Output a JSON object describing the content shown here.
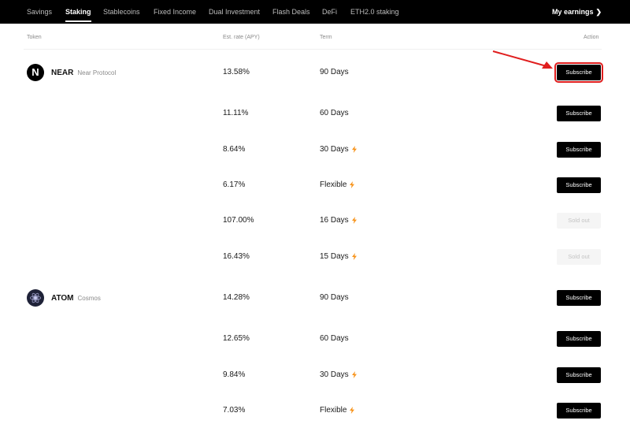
{
  "nav": {
    "items": [
      "Savings",
      "Staking",
      "Stablecoins",
      "Fixed Income",
      "Dual Investment",
      "Flash Deals",
      "DeFi",
      "ETH2.0 staking"
    ],
    "active": "Staking",
    "right": "My earnings"
  },
  "table": {
    "headers": {
      "token": "Token",
      "rate": "Est. rate (APY)",
      "term": "Term",
      "action": "Action"
    },
    "rows": [
      {
        "symbol": "NEAR",
        "name": "Near Protocol",
        "rate": "13.58%",
        "term": "90 Days",
        "flash": false,
        "action": "Subscribe",
        "highlighted": true
      },
      {
        "symbol": "",
        "name": "",
        "rate": "11.11%",
        "term": "60 Days",
        "flash": false,
        "action": "Subscribe"
      },
      {
        "symbol": "",
        "name": "",
        "rate": "8.64%",
        "term": "30 Days",
        "flash": true,
        "action": "Subscribe"
      },
      {
        "symbol": "",
        "name": "",
        "rate": "6.17%",
        "term": "Flexible",
        "flash": true,
        "action": "Subscribe"
      },
      {
        "symbol": "",
        "name": "",
        "rate": "107.00%",
        "term": "16 Days",
        "flash": true,
        "action": "Sold out"
      },
      {
        "symbol": "",
        "name": "",
        "rate": "16.43%",
        "term": "15 Days",
        "flash": true,
        "action": "Sold out"
      },
      {
        "symbol": "ATOM",
        "name": "Cosmos",
        "rate": "14.28%",
        "term": "90 Days",
        "flash": false,
        "action": "Subscribe"
      },
      {
        "symbol": "",
        "name": "",
        "rate": "12.65%",
        "term": "60 Days",
        "flash": false,
        "action": "Subscribe"
      },
      {
        "symbol": "",
        "name": "",
        "rate": "9.84%",
        "term": "30 Days",
        "flash": true,
        "action": "Subscribe"
      },
      {
        "symbol": "",
        "name": "",
        "rate": "7.03%",
        "term": "Flexible",
        "flash": true,
        "action": "Subscribe"
      }
    ]
  },
  "colors": {
    "nav_bg": "#000000",
    "flash": "#f7931a",
    "highlight": "#e01e1e",
    "button": "#000000"
  },
  "icons": {
    "flash": "lightning-bolt-icon",
    "near": "near-logo-icon",
    "atom": "cosmos-logo-icon",
    "chevron": "chevron-right-icon"
  }
}
